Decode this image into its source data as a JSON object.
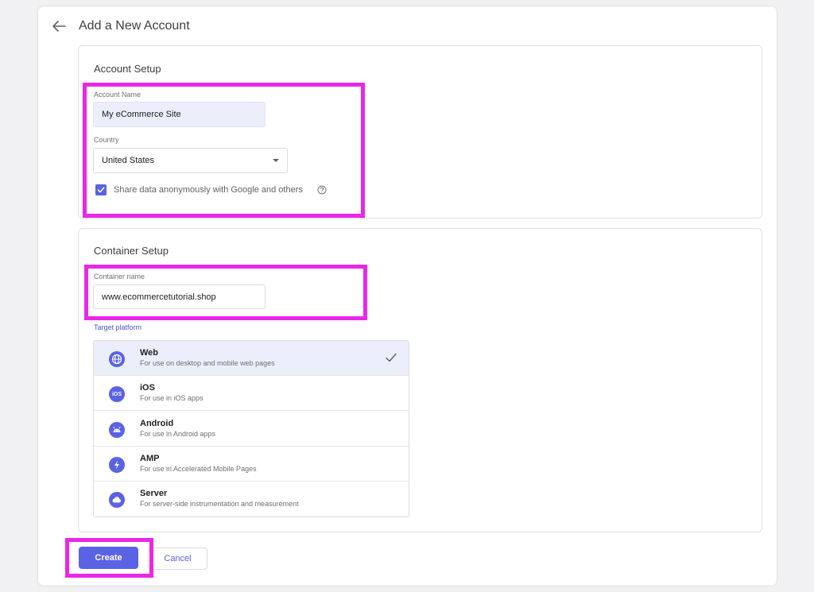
{
  "page": {
    "title": "Add a New Account"
  },
  "account_setup": {
    "title": "Account Setup",
    "account_name": {
      "label": "Account Name",
      "value": "My eCommerce Site"
    },
    "country": {
      "label": "Country",
      "value": "United States"
    },
    "share_data": {
      "label": "Share data anonymously with Google and others",
      "checked": true
    }
  },
  "container_setup": {
    "title": "Container Setup",
    "container_name": {
      "label": "Container name",
      "value": "www.ecommercetutorial.shop"
    },
    "target_platform": {
      "label": "Target platform",
      "options": [
        {
          "name": "Web",
          "description": "For use on desktop and mobile web pages",
          "selected": true,
          "icon": "globe-icon"
        },
        {
          "name": "iOS",
          "description": "For use in iOS apps",
          "selected": false,
          "icon": "ios-icon"
        },
        {
          "name": "Android",
          "description": "For use in Android apps",
          "selected": false,
          "icon": "android-icon"
        },
        {
          "name": "AMP",
          "description": "For use in Accelerated Mobile Pages",
          "selected": false,
          "icon": "lightning-icon"
        },
        {
          "name": "Server",
          "description": "For server-side instrumentation and measurement",
          "selected": false,
          "icon": "cloud-icon"
        }
      ],
      "ios_badge": "iOS"
    }
  },
  "actions": {
    "create_label": "Create",
    "cancel_label": "Cancel"
  },
  "colors": {
    "accent": "#5a62e6",
    "highlight": "#ea27e8",
    "selected_bg": "#eceefc"
  }
}
